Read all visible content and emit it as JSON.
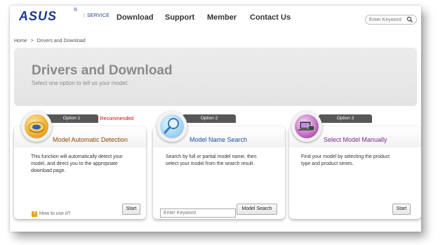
{
  "brand": {
    "logo_text": "ASUS",
    "service_label": "SERVICE"
  },
  "nav": {
    "items": [
      "Download",
      "Support",
      "Member",
      "Contact Us"
    ]
  },
  "search": {
    "placeholder": "Enter Keyword"
  },
  "breadcrumb": {
    "home": "Home",
    "separator": ">",
    "current": "Drivers and Download"
  },
  "hero": {
    "title": "Drivers and Download",
    "subtitle": "Select one option to tell us your model:"
  },
  "options": [
    {
      "tab": "Option 1",
      "title": "Model Automatic Detection",
      "title_color": "#8a4a0a",
      "recommended": "* Recommended",
      "desc": [
        "This function will automatically detect your",
        "model, and direct you to the appropriate",
        "download page."
      ],
      "help": "How to use it?",
      "button": "Start",
      "icon": "globe-icon"
    },
    {
      "tab": "Option 2",
      "title": "Model Name Search",
      "title_color": "#1a4fa0",
      "desc": [
        "Search by full or partial model name, then",
        "select your model from the search result."
      ],
      "input_placeholder": "Enter Keyword",
      "button": "Model Search",
      "icon": "magnifier-icon"
    },
    {
      "tab": "Option 3",
      "title": "Select Model Manually",
      "title_color": "#7a2a8a",
      "desc": [
        "Find your model by selecting the product",
        "type and product series."
      ],
      "button": "Start",
      "icon": "devices-icon"
    }
  ],
  "colors": {
    "brand_blue": "#1a3a8e",
    "tab_dark": "#575757",
    "recommended_red": "#d40000"
  }
}
